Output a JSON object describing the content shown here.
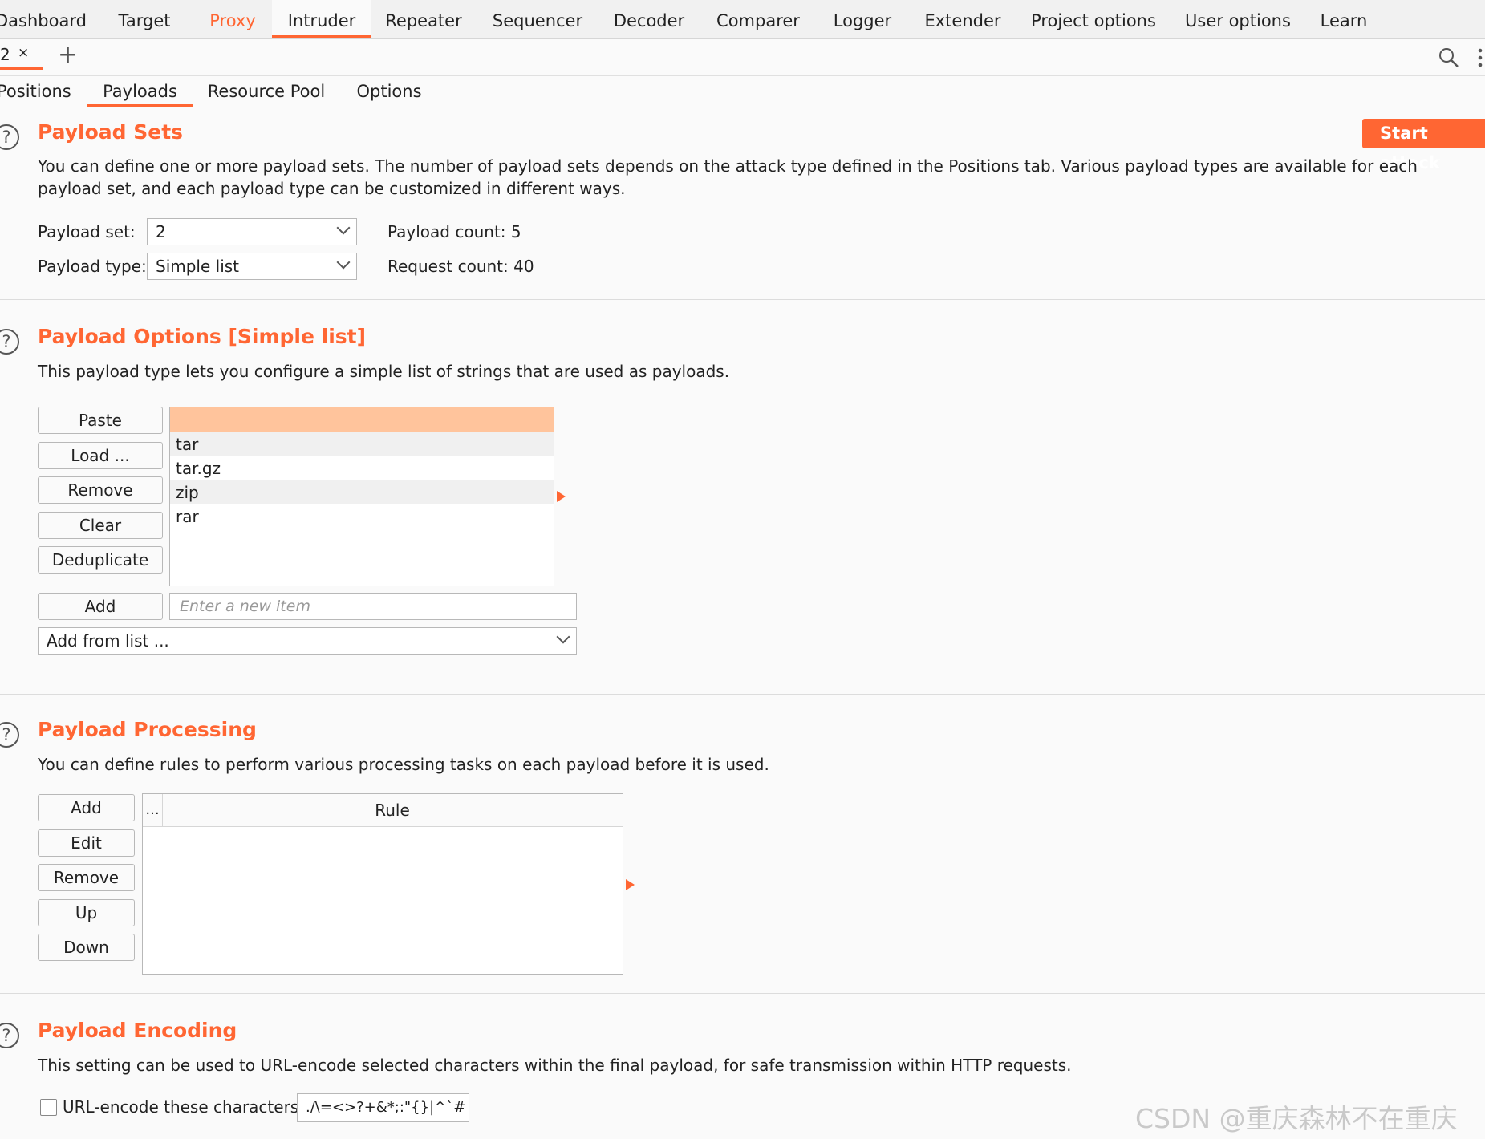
{
  "top_tabs": [
    "Dashboard",
    "Target",
    "Proxy",
    "Intruder",
    "Repeater",
    "Sequencer",
    "Decoder",
    "Comparer",
    "Logger",
    "Extender",
    "Project options",
    "User options",
    "Learn"
  ],
  "attack_tab": {
    "number": "2",
    "close": "×",
    "new": "+"
  },
  "sub_tabs": [
    "Positions",
    "Payloads",
    "Resource Pool",
    "Options"
  ],
  "start_attack": "Start attack",
  "payload_sets": {
    "title": "Payload Sets",
    "desc": "You can define one or more payload sets. The number of payload sets depends on the attack type defined in the Positions tab. Various payload types are available for each payload set, and each payload type can be customized in different ways.",
    "set_label": "Payload set:",
    "set_value": "2",
    "type_label": "Payload type:",
    "type_value": "Simple list",
    "count_label": "Payload count: 5",
    "request_label": "Request count: 40"
  },
  "payload_options": {
    "title": "Payload Options [Simple list]",
    "desc": "This payload type lets you configure a simple list of strings that are used as payloads.",
    "buttons": [
      "Paste",
      "Load ...",
      "Remove",
      "Clear",
      "Deduplicate"
    ],
    "items": [
      "",
      "tar",
      "tar.gz",
      "zip",
      "rar"
    ],
    "add_button": "Add",
    "add_placeholder": "Enter a new item",
    "add_from_list": "Add from list ..."
  },
  "payload_processing": {
    "title": "Payload Processing",
    "desc": "You can define rules to perform various processing tasks on each payload before it is used.",
    "buttons": [
      "Add",
      "Edit",
      "Remove",
      "Up",
      "Down"
    ],
    "col_enabled": "...",
    "col_rule": "Rule"
  },
  "payload_encoding": {
    "title": "Payload Encoding",
    "desc": "This setting can be used to URL-encode selected characters within the final payload, for safe transmission within HTTP requests.",
    "checkbox_label": "URL-encode these characters:",
    "chars": "./\\=<>?+&*;:\"{}|^`#"
  },
  "watermark": "CSDN @重庆森林不在重庆",
  "colors": {
    "accent": "#ff6633",
    "selection": "#ffc49c"
  }
}
